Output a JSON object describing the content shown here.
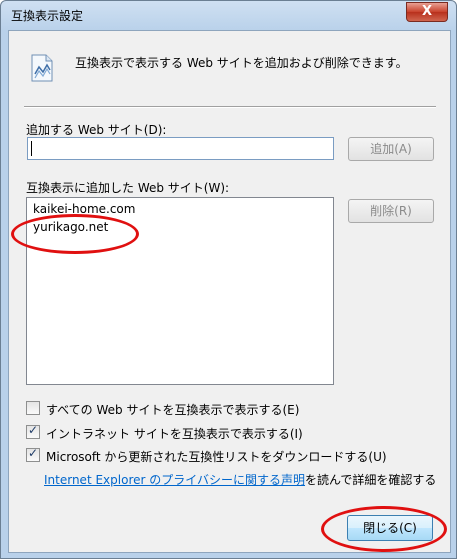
{
  "window": {
    "title": "互換表示設定",
    "close_glyph": "X"
  },
  "intro": {
    "text": "互換表示で表示する Web サイトを追加および削除できます。"
  },
  "add_section": {
    "label": "追加する Web サイト(D):",
    "input_value": "",
    "add_button": "追加(A)"
  },
  "list_section": {
    "label": "互換表示に追加した Web サイト(W):",
    "items": [
      "kaikei-home.com",
      "yurikago.net"
    ],
    "remove_button": "削除(R)"
  },
  "options": [
    {
      "label": "すべての Web サイトを互換表示で表示する(E)",
      "checked": false
    },
    {
      "label": "イントラネット サイトを互換表示で表示する(I)",
      "checked": true
    },
    {
      "label": "Microsoft から更新された互換性リストをダウンロードする(U)",
      "checked": true
    }
  ],
  "privacy": {
    "link_text": "Internet Explorer のプライバシーに関する声明",
    "suffix": "を読んで詳細を確認する"
  },
  "footer": {
    "close_button": "閉じる(C)"
  },
  "colors": {
    "highlight_ring": "#e01010",
    "link": "#0066cc",
    "titlebar_close": "#c8412b"
  }
}
